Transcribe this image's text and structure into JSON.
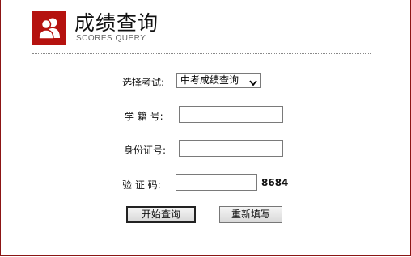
{
  "header": {
    "title": "成绩查询",
    "subtitle": "SCORES QUERY",
    "logo_icon": "users-icon",
    "logo_color": "#b5120f"
  },
  "form": {
    "exam_label": "选择考试:",
    "exam_selected": "中考成绩查询",
    "student_id_label": "学 籍 号:",
    "student_id_value": "",
    "id_card_label": "身份证号:",
    "id_card_value": "",
    "captcha_label": "验 证 码:",
    "captcha_value": "",
    "captcha_code": "8684"
  },
  "buttons": {
    "submit_label": "开始查询",
    "reset_label": "重新填写"
  },
  "colors": {
    "accent": "#b5120f",
    "border": "#8c1515"
  }
}
